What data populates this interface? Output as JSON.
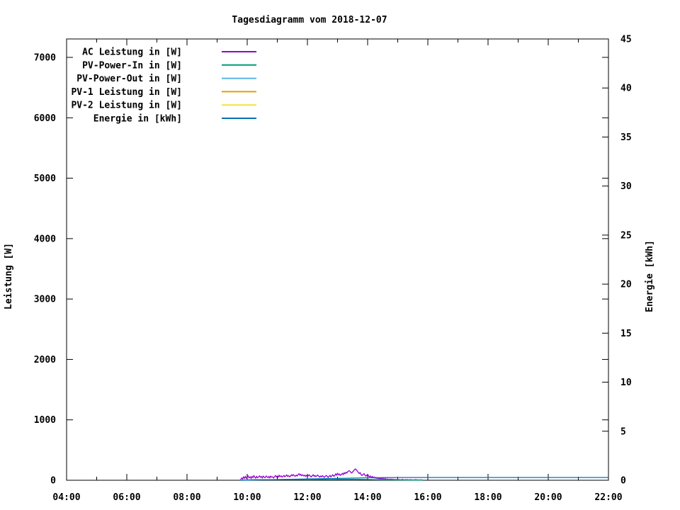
{
  "page": {
    "background": "#ffffff",
    "foreground": "#000000"
  },
  "chart_data": {
    "type": "line",
    "title": "Tagesdiagramm vom 2018-12-07",
    "grid": false,
    "legend_position": "top-left-inside",
    "x_axis": {
      "unit": "time",
      "range_hours": [
        4,
        22
      ],
      "major_tick_step_hours": 2,
      "minor_tick_step_hours": 1,
      "tick_labels": [
        "04:00",
        "06:00",
        "08:00",
        "10:00",
        "12:00",
        "14:00",
        "16:00",
        "18:00",
        "20:00",
        "22:00"
      ]
    },
    "y_axis_left": {
      "label": "Leistung [W]",
      "range": [
        0,
        7305
      ],
      "tick_step": 1000,
      "tick_labels": [
        "0",
        "1000",
        "2000",
        "3000",
        "4000",
        "5000",
        "6000",
        "7000"
      ]
    },
    "y_axis_right": {
      "label": "Energie [kWh]",
      "range": [
        0,
        45
      ],
      "tick_step": 5,
      "tick_labels": [
        "0",
        "5",
        "10",
        "15",
        "20",
        "25",
        "30",
        "35",
        "40",
        "45"
      ]
    },
    "series": [
      {
        "name": "AC Leistung in [W]",
        "color": "#9400D3",
        "axis": "left",
        "points": [
          [
            9.78,
            12
          ],
          [
            9.82,
            38
          ],
          [
            9.85,
            22
          ],
          [
            9.88,
            55
          ],
          [
            9.91,
            30
          ],
          [
            9.94,
            62
          ],
          [
            9.97,
            35
          ],
          [
            10.0,
            50
          ],
          [
            10.03,
            72
          ],
          [
            10.06,
            40
          ],
          [
            10.1,
            58
          ],
          [
            10.13,
            30
          ],
          [
            10.16,
            62
          ],
          [
            10.19,
            45
          ],
          [
            10.22,
            75
          ],
          [
            10.25,
            52
          ],
          [
            10.28,
            35
          ],
          [
            10.31,
            65
          ],
          [
            10.34,
            42
          ],
          [
            10.38,
            58
          ],
          [
            10.41,
            72
          ],
          [
            10.44,
            48
          ],
          [
            10.47,
            62
          ],
          [
            10.5,
            38
          ],
          [
            10.53,
            68
          ],
          [
            10.56,
            50
          ],
          [
            10.59,
            42
          ],
          [
            10.63,
            70
          ],
          [
            10.66,
            55
          ],
          [
            10.69,
            45
          ],
          [
            10.72,
            62
          ],
          [
            10.75,
            40
          ],
          [
            10.78,
            68
          ],
          [
            10.81,
            52
          ],
          [
            10.84,
            58
          ],
          [
            10.88,
            38
          ],
          [
            10.91,
            62
          ],
          [
            10.94,
            78
          ],
          [
            10.97,
            55
          ],
          [
            11.0,
            70
          ],
          [
            11.03,
            50
          ],
          [
            11.06,
            82
          ],
          [
            11.09,
            60
          ],
          [
            11.13,
            72
          ],
          [
            11.16,
            52
          ],
          [
            11.19,
            66
          ],
          [
            11.22,
            80
          ],
          [
            11.25,
            58
          ],
          [
            11.28,
            72
          ],
          [
            11.31,
            88
          ],
          [
            11.34,
            65
          ],
          [
            11.38,
            76
          ],
          [
            11.41,
            56
          ],
          [
            11.44,
            70
          ],
          [
            11.47,
            90
          ],
          [
            11.5,
            74
          ],
          [
            11.53,
            95
          ],
          [
            11.56,
            78
          ],
          [
            11.59,
            64
          ],
          [
            11.63,
            85
          ],
          [
            11.66,
            70
          ],
          [
            11.69,
            92
          ],
          [
            11.72,
            108
          ],
          [
            11.75,
            85
          ],
          [
            11.78,
            98
          ],
          [
            11.81,
            76
          ],
          [
            11.84,
            90
          ],
          [
            11.88,
            70
          ],
          [
            11.91,
            84
          ],
          [
            11.94,
            64
          ],
          [
            11.97,
            80
          ],
          [
            12.0,
            60
          ],
          [
            12.03,
            76
          ],
          [
            12.06,
            90
          ],
          [
            12.09,
            70
          ],
          [
            12.13,
            56
          ],
          [
            12.16,
            76
          ],
          [
            12.19,
            90
          ],
          [
            12.22,
            66
          ],
          [
            12.25,
            80
          ],
          [
            12.28,
            60
          ],
          [
            12.31,
            72
          ],
          [
            12.34,
            86
          ],
          [
            12.38,
            66
          ],
          [
            12.41,
            52
          ],
          [
            12.44,
            70
          ],
          [
            12.47,
            56
          ],
          [
            12.5,
            76
          ],
          [
            12.53,
            62
          ],
          [
            12.56,
            48
          ],
          [
            12.59,
            66
          ],
          [
            12.63,
            80
          ],
          [
            12.66,
            62
          ],
          [
            12.69,
            46
          ],
          [
            12.72,
            66
          ],
          [
            12.75,
            80
          ],
          [
            12.78,
            56
          ],
          [
            12.81,
            72
          ],
          [
            12.84,
            90
          ],
          [
            12.88,
            66
          ],
          [
            12.91,
            80
          ],
          [
            12.94,
            104
          ],
          [
            12.97,
            84
          ],
          [
            13.0,
            114
          ],
          [
            13.03,
            90
          ],
          [
            13.06,
            104
          ],
          [
            13.09,
            80
          ],
          [
            13.13,
            95
          ],
          [
            13.16,
            114
          ],
          [
            13.19,
            95
          ],
          [
            13.22,
            124
          ],
          [
            13.25,
            108
          ],
          [
            13.28,
            132
          ],
          [
            13.31,
            118
          ],
          [
            13.34,
            142
          ],
          [
            13.38,
            160
          ],
          [
            13.41,
            150
          ],
          [
            13.44,
            132
          ],
          [
            13.47,
            120
          ],
          [
            13.5,
            138
          ],
          [
            13.53,
            155
          ],
          [
            13.56,
            172
          ],
          [
            13.59,
            188
          ],
          [
            13.63,
            170
          ],
          [
            13.66,
            150
          ],
          [
            13.69,
            128
          ],
          [
            13.72,
            112
          ],
          [
            13.75,
            126
          ],
          [
            13.78,
            96
          ],
          [
            13.81,
            78
          ],
          [
            13.84,
            92
          ],
          [
            13.88,
            110
          ],
          [
            13.91,
            86
          ],
          [
            13.94,
            68
          ],
          [
            13.97,
            82
          ],
          [
            14.0,
            96
          ],
          [
            14.03,
            72
          ],
          [
            14.06,
            58
          ],
          [
            14.09,
            72
          ],
          [
            14.13,
            48
          ],
          [
            14.16,
            62
          ],
          [
            14.19,
            40
          ],
          [
            14.22,
            54
          ],
          [
            14.25,
            34
          ],
          [
            14.28,
            48
          ],
          [
            14.31,
            28
          ],
          [
            14.34,
            40
          ],
          [
            14.38,
            24
          ],
          [
            14.41,
            34
          ],
          [
            14.44,
            20
          ],
          [
            14.47,
            32
          ],
          [
            14.5,
            18
          ],
          [
            14.53,
            28
          ],
          [
            14.56,
            16
          ],
          [
            14.59,
            26
          ],
          [
            14.63,
            12
          ],
          [
            14.66,
            22
          ],
          [
            14.69,
            14
          ],
          [
            14.72,
            10
          ],
          [
            14.75,
            20
          ],
          [
            14.78,
            12
          ],
          [
            14.81,
            18
          ],
          [
            14.84,
            10
          ],
          [
            14.88,
            15
          ],
          [
            14.91,
            8
          ],
          [
            14.94,
            14
          ],
          [
            14.97,
            10
          ],
          [
            15.0,
            16
          ],
          [
            15.03,
            8
          ],
          [
            15.06,
            12
          ],
          [
            15.09,
            6
          ],
          [
            15.13,
            10
          ],
          [
            15.16,
            14
          ],
          [
            15.19,
            8
          ],
          [
            15.22,
            5
          ],
          [
            15.25,
            10
          ],
          [
            15.28,
            6
          ],
          [
            15.31,
            12
          ],
          [
            15.34,
            8
          ],
          [
            15.38,
            5
          ],
          [
            15.41,
            10
          ],
          [
            15.44,
            6
          ],
          [
            15.47,
            8
          ],
          [
            15.5,
            4
          ],
          [
            15.53,
            8
          ],
          [
            15.56,
            5
          ],
          [
            15.59,
            10
          ],
          [
            15.63,
            6
          ],
          [
            15.66,
            8
          ],
          [
            15.69,
            4
          ],
          [
            15.72,
            7
          ],
          [
            15.75,
            5
          ],
          [
            15.78,
            8
          ],
          [
            15.81,
            5
          ],
          [
            15.83,
            6
          ]
        ]
      },
      {
        "name": "PV-Power-In in [W]",
        "color": "#009E73",
        "axis": "left",
        "points": [
          [
            9.78,
            3
          ],
          [
            10.0,
            6
          ],
          [
            10.25,
            9
          ],
          [
            10.5,
            11
          ],
          [
            10.75,
            9
          ],
          [
            11.0,
            10
          ],
          [
            11.25,
            12
          ],
          [
            11.5,
            11
          ],
          [
            11.75,
            13
          ],
          [
            12.0,
            11
          ],
          [
            12.25,
            12
          ],
          [
            12.5,
            13
          ],
          [
            12.75,
            12
          ],
          [
            13.0,
            14
          ],
          [
            13.25,
            15
          ],
          [
            13.5,
            16
          ],
          [
            13.75,
            14
          ],
          [
            14.0,
            13
          ],
          [
            14.25,
            10
          ],
          [
            14.5,
            8
          ],
          [
            14.75,
            7
          ],
          [
            15.0,
            6
          ],
          [
            15.25,
            5
          ],
          [
            15.5,
            4
          ],
          [
            15.83,
            3
          ]
        ]
      },
      {
        "name": "PV-Power-Out in [W]",
        "color": "#56B4E9",
        "axis": "left",
        "points": []
      },
      {
        "name": "PV-1 Leistung in [W]",
        "color": "#E69F00",
        "axis": "left",
        "points": []
      },
      {
        "name": "PV-2 Leistung in [W]",
        "color": "#F0E442",
        "axis": "left",
        "points": []
      },
      {
        "name": "Energie in [kWh]",
        "color": "#0072B2",
        "axis": "right",
        "points": [
          [
            9.78,
            0
          ],
          [
            10.0,
            0.01
          ],
          [
            10.5,
            0.04
          ],
          [
            11.0,
            0.07
          ],
          [
            11.5,
            0.1
          ],
          [
            12.0,
            0.13
          ],
          [
            12.5,
            0.16
          ],
          [
            13.0,
            0.19
          ],
          [
            13.5,
            0.22
          ],
          [
            14.0,
            0.25
          ],
          [
            14.5,
            0.27
          ],
          [
            15.0,
            0.28
          ],
          [
            15.5,
            0.28
          ],
          [
            16.0,
            0.28
          ],
          [
            22.0,
            0.28
          ]
        ]
      }
    ]
  }
}
